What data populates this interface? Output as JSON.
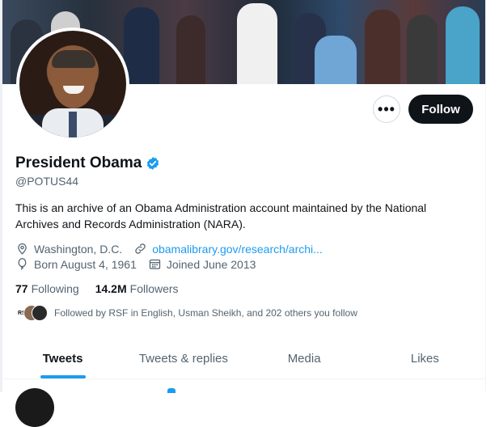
{
  "profile": {
    "display_name": "President Obama",
    "handle": "@POTUS44",
    "bio": "This is an archive of an Obama Administration account maintained by the National Archives and Records Administration (NARA).",
    "location": "Washington, D.C.",
    "website": "obamalibrary.gov/research/archi...",
    "birthday": "Born August 4, 1961",
    "joined": "Joined June 2013",
    "following_count": "77",
    "following_label": "Following",
    "followers_count": "14.2M",
    "followers_label": "Followers",
    "followed_by": "Followed by RSF in English, Usman Sheikh, and 202 others you follow",
    "mini_avatar_label": "RSF"
  },
  "actions": {
    "more_label": "•••",
    "follow_label": "Follow"
  },
  "tabs": [
    {
      "label": "Tweets",
      "active": true
    },
    {
      "label": "Tweets & replies",
      "active": false
    },
    {
      "label": "Media",
      "active": false
    },
    {
      "label": "Likes",
      "active": false
    }
  ],
  "colors": {
    "accent": "#1d9bf0",
    "text": "#0f1419",
    "secondary": "#536471"
  },
  "icons": {
    "verified": "verified-badge-icon",
    "location": "location-pin-icon",
    "link": "link-icon",
    "birthday": "balloon-icon",
    "calendar": "calendar-icon"
  }
}
